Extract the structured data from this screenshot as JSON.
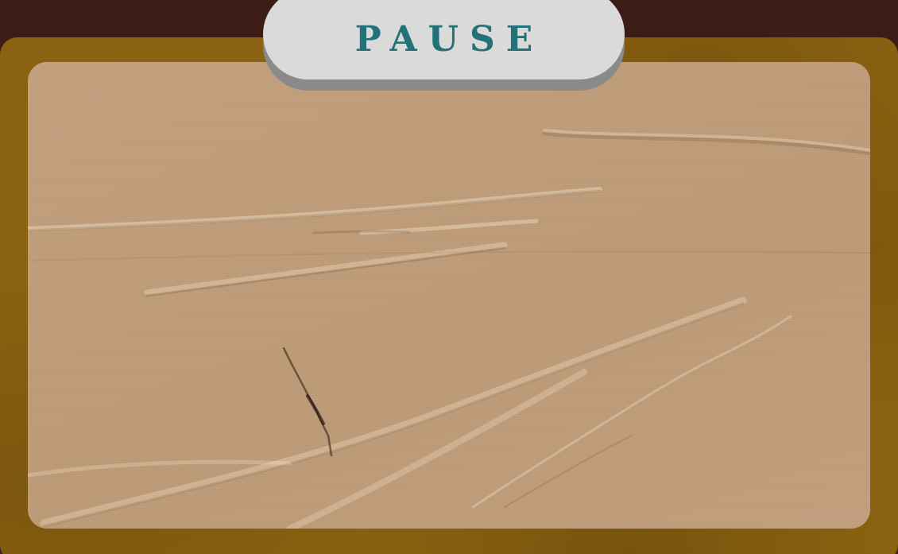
{
  "screen": {
    "title": "PAUSE"
  },
  "colors": {
    "background": "#3b1d16",
    "frame": "#8a6211",
    "paper": "#c09d7b",
    "pill": "#dadada",
    "pill_shadow": "#8a8a8a",
    "title_text": "#237278"
  }
}
